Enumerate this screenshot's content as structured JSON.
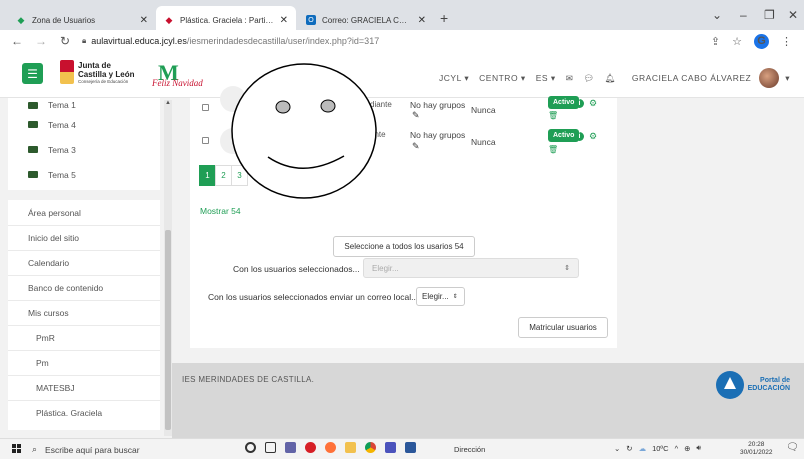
{
  "browser": {
    "tabs": [
      {
        "label": "Zona de Usuarios",
        "icon": "moodle-icon",
        "active": false
      },
      {
        "label": "Plástica. Graciela : Participantes",
        "icon": "moodle-icon",
        "active": true
      },
      {
        "label": "Correo: GRACIELA CABO ÁLVARE",
        "icon": "outlook-icon",
        "active": false
      }
    ],
    "new_tab": "+",
    "url_host": "aulavirtual.educa.jcyl.es",
    "url_path": "/iesmerindadesdecastilla/user/index.php?id=317",
    "profile_initial": "G"
  },
  "navbar": {
    "brand_line1": "Junta de",
    "brand_line2": "Castilla y León",
    "brand_sub": "Consejería de Educación",
    "brand2_mark": "M",
    "brand2_text": "Feliz Navidad",
    "menu": [
      "JCYL",
      "CENTRO",
      "ES"
    ],
    "user_name": "GRACIELA CABO ÁLVAREZ",
    "accent": "#1f9e55"
  },
  "sidebar": {
    "topics": [
      "Tema 1",
      "Tema 4",
      "Tema 3",
      "Tema 5"
    ],
    "nav": [
      "Área personal",
      "Inicio del sitio",
      "Calendario",
      "Banco de contenido",
      "Mis cursos"
    ],
    "courses": [
      "PmR",
      "Pm",
      "MATESBJ",
      "Plástica. Graciela"
    ]
  },
  "participants": {
    "rows": [
      {
        "role": "diante",
        "groups": "No hay grupos",
        "last_access": "Nunca",
        "status": "Activo"
      },
      {
        "role": "ante",
        "groups": "No hay grupos",
        "last_access": "Nunca",
        "status": "Activo"
      }
    ],
    "pages": [
      "1",
      "2",
      "3"
    ],
    "current_page": "1",
    "show_all": "Mostrar 54",
    "select_all": "Seleccione a todos los usarios 54",
    "with_selected_label": "Con los usuarios seleccionados...",
    "with_selected_placeholder": "Elegir...",
    "send_mail_label": "Con los usuarios seleccionados enviar un correo local...",
    "send_mail_value": "Elegir...",
    "enrol_button": "Matricular usuarios"
  },
  "footer": {
    "school": "IES MERINDADES DE CASTILLA.",
    "portal_line1": "Portal de",
    "portal_line2": "EDUCACIÓN"
  },
  "taskbar": {
    "search_placeholder": "Escribe aquí para buscar",
    "address_label": "Dirección",
    "temperature": "10ºC",
    "time": "20:28",
    "date": "30/01/2022"
  }
}
